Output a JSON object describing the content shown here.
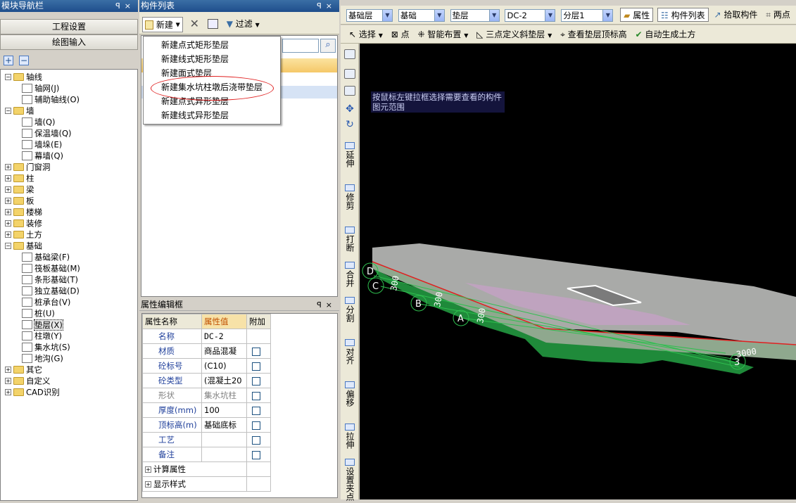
{
  "nav_panel": {
    "title": "模块导航栏",
    "pin": "ꟼ",
    "close": "×",
    "buttons": [
      "工程设置",
      "绘图输入"
    ],
    "tree": [
      {
        "label": "轴线",
        "level": 0,
        "expanded": true,
        "type": "folder"
      },
      {
        "label": "轴网(J)",
        "level": 1,
        "type": "item"
      },
      {
        "label": "辅助轴线(O)",
        "level": 1,
        "type": "item"
      },
      {
        "label": "墙",
        "level": 0,
        "expanded": true,
        "type": "folder"
      },
      {
        "label": "墙(Q)",
        "level": 1,
        "type": "item"
      },
      {
        "label": "保温墙(Q)",
        "level": 1,
        "type": "item"
      },
      {
        "label": "墙垛(E)",
        "level": 1,
        "type": "item"
      },
      {
        "label": "幕墙(Q)",
        "level": 1,
        "type": "item"
      },
      {
        "label": "门窗洞",
        "level": 0,
        "expanded": false,
        "type": "folder"
      },
      {
        "label": "柱",
        "level": 0,
        "expanded": false,
        "type": "folder"
      },
      {
        "label": "梁",
        "level": 0,
        "expanded": false,
        "type": "folder"
      },
      {
        "label": "板",
        "level": 0,
        "expanded": false,
        "type": "folder"
      },
      {
        "label": "楼梯",
        "level": 0,
        "expanded": false,
        "type": "folder"
      },
      {
        "label": "装修",
        "level": 0,
        "expanded": false,
        "type": "folder"
      },
      {
        "label": "土方",
        "level": 0,
        "expanded": false,
        "type": "folder"
      },
      {
        "label": "基础",
        "level": 0,
        "expanded": true,
        "type": "folder"
      },
      {
        "label": "基础梁(F)",
        "level": 1,
        "type": "item"
      },
      {
        "label": "筏板基础(M)",
        "level": 1,
        "type": "item"
      },
      {
        "label": "条形基础(T)",
        "level": 1,
        "type": "item"
      },
      {
        "label": "独立基础(D)",
        "level": 1,
        "type": "item"
      },
      {
        "label": "桩承台(V)",
        "level": 1,
        "type": "item"
      },
      {
        "label": "桩(U)",
        "level": 1,
        "type": "item"
      },
      {
        "label": "垫层(X)",
        "level": 1,
        "type": "item",
        "selected": true
      },
      {
        "label": "柱墩(Y)",
        "level": 1,
        "type": "item"
      },
      {
        "label": "集水坑(S)",
        "level": 1,
        "type": "item"
      },
      {
        "label": "地沟(G)",
        "level": 1,
        "type": "item"
      },
      {
        "label": "其它",
        "level": 0,
        "expanded": false,
        "type": "folder"
      },
      {
        "label": "自定义",
        "level": 0,
        "expanded": false,
        "type": "folder"
      },
      {
        "label": "CAD识别",
        "level": 0,
        "expanded": false,
        "type": "folder"
      }
    ]
  },
  "component_panel": {
    "title": "构件列表",
    "new_label": "新建",
    "filter_label": "过滤",
    "menu_items": [
      "新建点式矩形垫层",
      "新建线式矩形垫层",
      "新建面式垫层",
      "新建集水坑柱墩后浇带垫层",
      "新建点式异形垫层",
      "新建线式异形垫层"
    ]
  },
  "property_panel": {
    "title": "属性编辑框",
    "headers": [
      "属性名称",
      "属性值",
      "附加"
    ],
    "rows": [
      {
        "name": "名称",
        "value": "DC-2",
        "check": false,
        "gray": false
      },
      {
        "name": "材质",
        "value": "商品混凝",
        "check": true,
        "gray": false
      },
      {
        "name": "砼标号",
        "value": "(C10)",
        "check": true,
        "gray": false
      },
      {
        "name": "砼类型",
        "value": "(混凝土20",
        "check": true,
        "gray": false
      },
      {
        "name": "形状",
        "value": "集水坑柱",
        "check": true,
        "gray": true
      },
      {
        "name": "厚度(mm)",
        "value": "100",
        "check": true,
        "gray": false
      },
      {
        "name": "顶标高(m)",
        "value": "基础底标",
        "check": true,
        "gray": false
      },
      {
        "name": "工艺",
        "value": "",
        "check": true,
        "gray": false
      },
      {
        "name": "备注",
        "value": "",
        "check": true,
        "gray": false
      }
    ],
    "groups": [
      "计算属性",
      "显示样式"
    ]
  },
  "toolbar1": {
    "combos": [
      "基础层",
      "基础",
      "垫层",
      "DC-2",
      "分层1"
    ],
    "buttons": [
      "属性",
      "构件列表",
      "拾取构件",
      "两点"
    ]
  },
  "toolbar2": {
    "buttons": [
      "选择",
      "点",
      "智能布置",
      "三点定义斜垫层",
      "查看垫层顶标高",
      "自动生成土方"
    ]
  },
  "vertical_tools": [
    "延伸",
    "修剪",
    "打断",
    "合并",
    "分割",
    "对齐",
    "偏移",
    "拉伸",
    "设置夹点"
  ],
  "canvas": {
    "hint": "按鼠标左键拉框选择需要查看的构件图元范围",
    "axis_labels": [
      "D",
      "C",
      "B",
      "A",
      "3"
    ],
    "dims": [
      "300",
      "300",
      "300",
      "3000"
    ]
  },
  "colors": {
    "accent": "#1f4e8c",
    "highlight_oval": "#e02020",
    "canvas_bg": "#000000",
    "slab": "#a9aaa8",
    "green": "#1f8a3a"
  }
}
